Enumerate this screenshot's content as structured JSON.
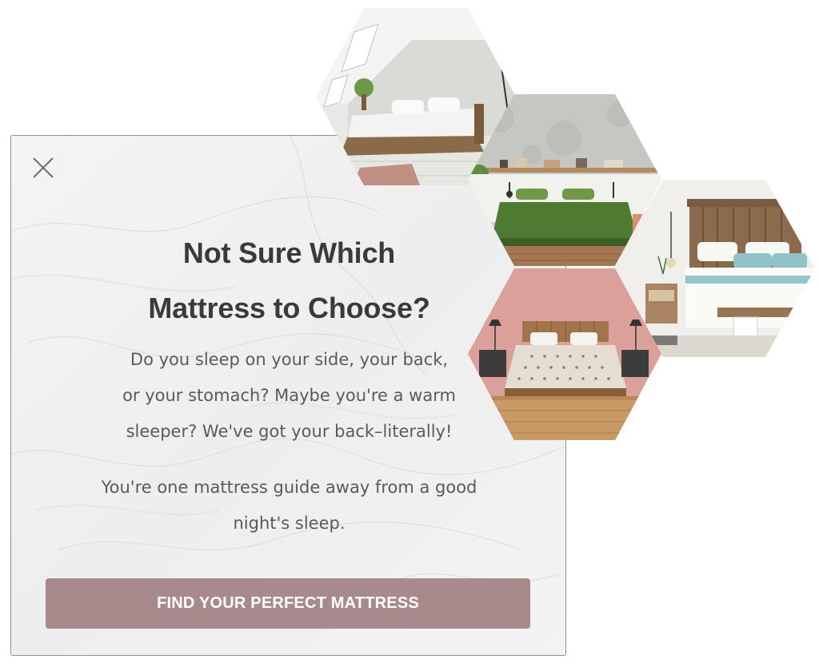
{
  "modal": {
    "headline_line1": "Not Sure Which",
    "headline_line2": "Mattress to Choose?",
    "body_line1": "Do you sleep on your side, your back,",
    "body_line2": "or your stomach? Maybe you're a warm",
    "body_line3": "sleeper? We've got your back–literally!",
    "body2_line1": "You're one mattress guide away from a good",
    "body2_line2": "night's sleep.",
    "cta_label": "FIND YOUR PERFECT MATTRESS",
    "close_icon": "close-icon"
  },
  "gallery": {
    "images": [
      "bedroom-attic-white-bed",
      "bedroom-green-bedding-concrete-wall",
      "bedroom-wood-headboard-blue-pillows",
      "bedroom-pink-wall-polka-dot-bedding"
    ]
  },
  "colors": {
    "cta_bg": "#a88a8c",
    "headline": "#3a3a3a",
    "body": "#5a5a5a"
  }
}
